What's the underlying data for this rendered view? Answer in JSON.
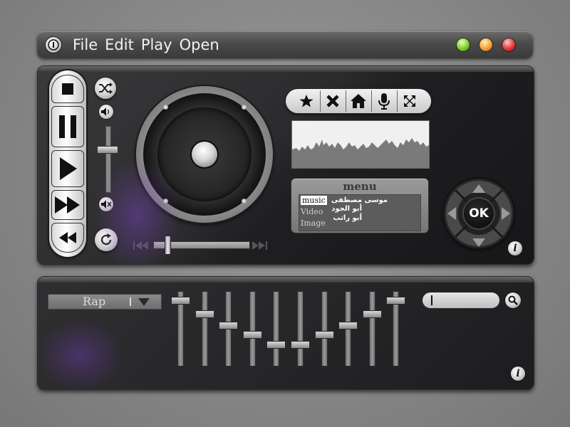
{
  "titlebar": {
    "menu": [
      "File",
      "Edit",
      "Play",
      "Open"
    ],
    "lights": {
      "green": "#7fcc2a",
      "orange": "#f2a23a",
      "red": "#e43a3a"
    }
  },
  "transport": {
    "buttons": [
      "stop-icon",
      "pause-icon",
      "play-icon",
      "fast-forward-icon",
      "rewind-icon"
    ]
  },
  "side_controls": {
    "icons": [
      "shuffle-icon",
      "volume-icon",
      "mute-icon",
      "repeat-icon"
    ],
    "volume_level": 0.65
  },
  "seek": {
    "position": 0.12,
    "icons": [
      "skip-back-icon",
      "skip-forward-icon"
    ]
  },
  "toolbar": {
    "icons": [
      "star-icon",
      "close-icon",
      "home-icon",
      "microphone-icon",
      "fullscreen-icon"
    ]
  },
  "menu_box": {
    "title": "menu",
    "options": [
      "music",
      "Video",
      "Image"
    ],
    "selected": "music",
    "songs": [
      "موسى مصطفى",
      "أبو الجود",
      "أبو راتب"
    ]
  },
  "dpad": {
    "ok_label": "OK",
    "icons": [
      "arrow-up-icon",
      "arrow-right-icon",
      "arrow-down-icon",
      "arrow-left-icon"
    ]
  },
  "info_label": "i",
  "equalizer": {
    "genre": "Rap",
    "band_levels": [
      0.12,
      0.3,
      0.45,
      0.58,
      0.71,
      0.71,
      0.58,
      0.45,
      0.3,
      0.12
    ]
  },
  "search": {
    "value": "",
    "icon": "search-icon"
  }
}
